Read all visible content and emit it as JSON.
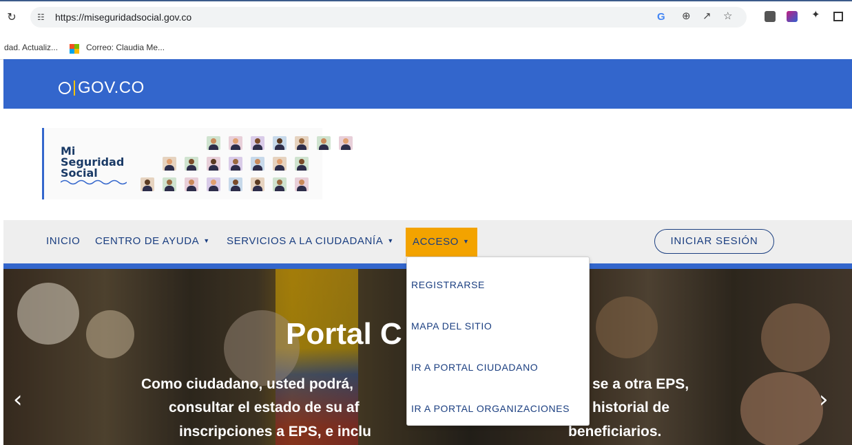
{
  "browser": {
    "url": "https://miseguridadsocial.gov.co",
    "bookmarks": [
      {
        "label": "dad. Actualiz..."
      },
      {
        "label": "Correo: Claudia Me..."
      }
    ]
  },
  "gov_bar": {
    "brand": "GOV.CO"
  },
  "header": {
    "logo_text": "Mi Seguridad Social"
  },
  "nav": {
    "items": [
      {
        "label": "INICIO"
      },
      {
        "label": "CENTRO DE AYUDA"
      },
      {
        "label": "SERVICIOS A LA CIUDADANÍA"
      },
      {
        "label": "ACCESO"
      }
    ],
    "login_label": "INICIAR SESIÓN"
  },
  "dropdown": {
    "items": [
      {
        "label": "REGISTRARSE"
      },
      {
        "label": "MAPA DEL SITIO"
      },
      {
        "label": "IR A PORTAL CIUDADANO"
      },
      {
        "label": "IR A PORTAL ORGANIZACIONES"
      }
    ]
  },
  "hero": {
    "title": "Portal C",
    "lines": [
      "Como ciudadano, usted podrá,",
      "se a otra EPS,",
      "consultar el estado de su af",
      "historial de",
      "inscripciones a EPS, e inclu",
      "beneficiarios."
    ]
  },
  "colors": {
    "gov_blue": "#3366cc",
    "nav_text": "#1a3e80",
    "acceso_active": "#f3a300"
  }
}
